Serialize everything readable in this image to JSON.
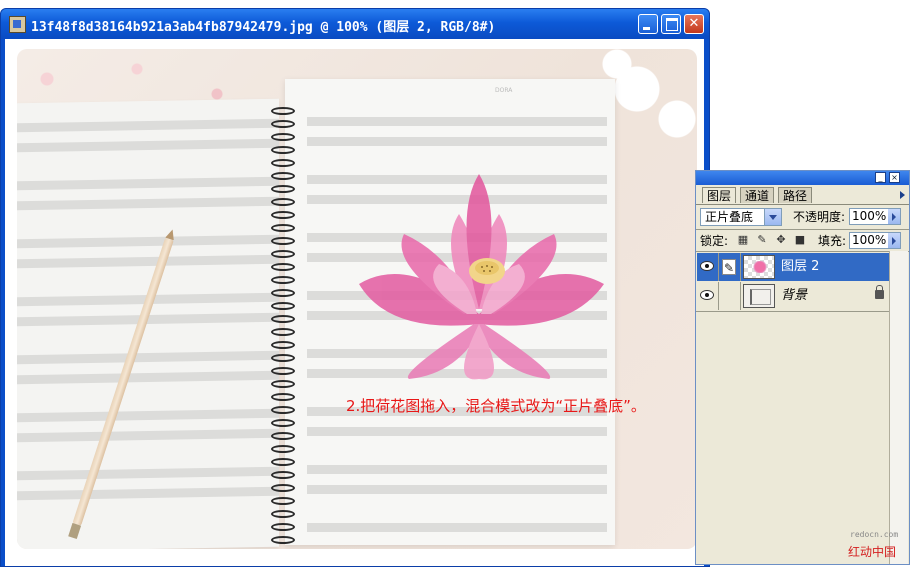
{
  "document": {
    "title": "13f48f8d38164b921a3ab4fb87942479.jpg @ 100% (图层 2, RGB/8#)"
  },
  "canvas": {
    "annotation": "2.把荷花图拖入，混合模式改为“正片叠底”。",
    "page_mark": "DORA"
  },
  "layers_panel": {
    "tabs": [
      "图层",
      "通道",
      "路径"
    ],
    "blend_mode": "正片叠底",
    "opacity_label": "不透明度:",
    "opacity_value": "100%",
    "lock_label": "锁定:",
    "fill_label": "填充:",
    "fill_value": "100%",
    "layers": [
      {
        "name": "图层 2",
        "selected": true
      },
      {
        "name": "背景",
        "selected": false,
        "locked": true
      }
    ]
  },
  "watermark": {
    "url": "redocn.com",
    "site": "红动中国"
  }
}
